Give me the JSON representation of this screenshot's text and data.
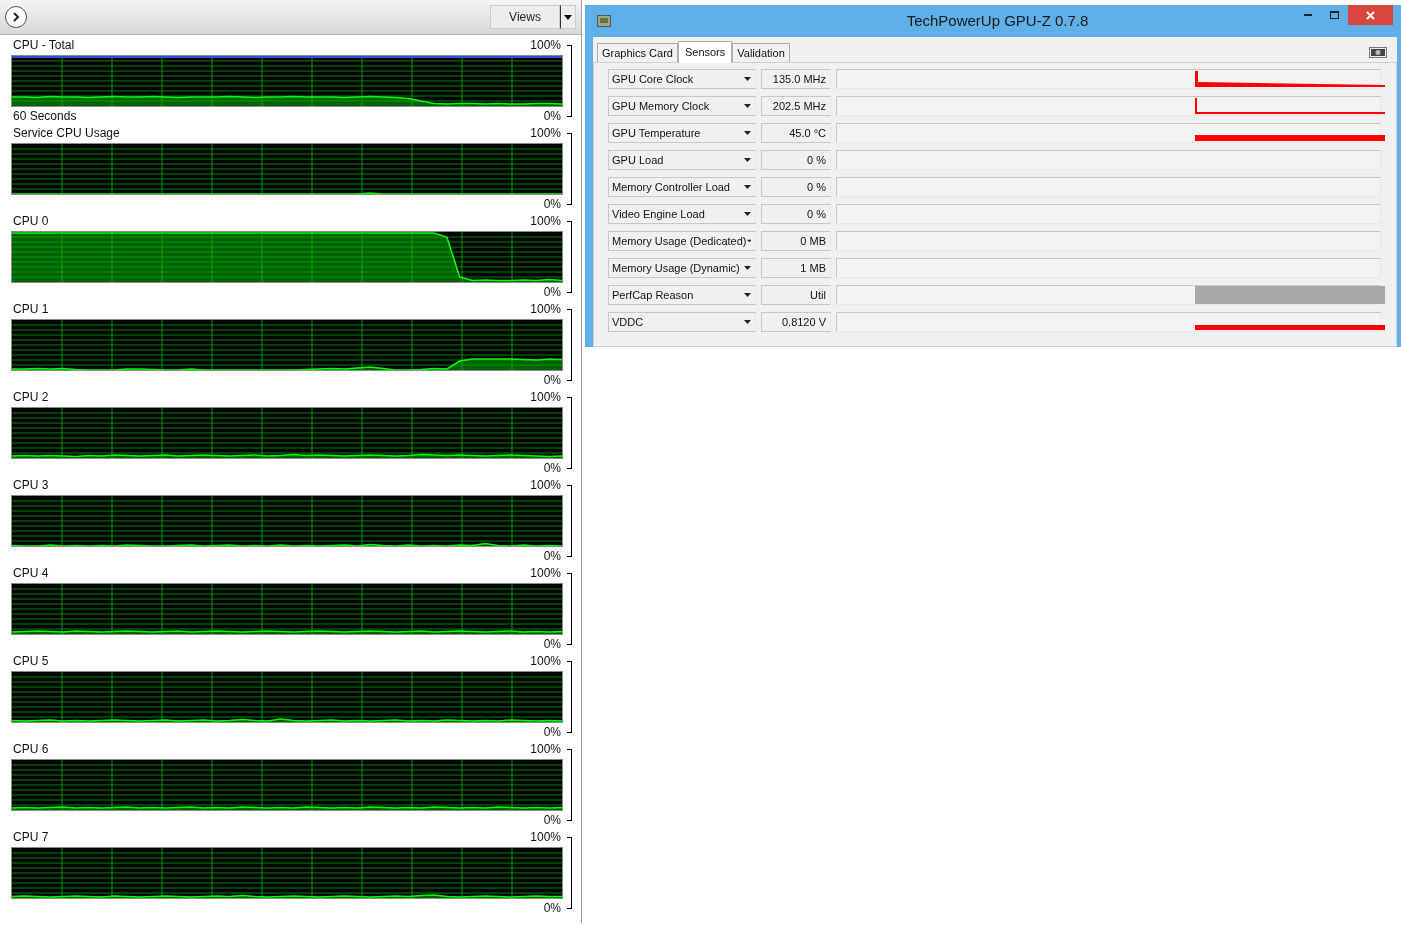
{
  "resource_monitor": {
    "views_button": "Views",
    "graphs": [
      {
        "title": "CPU - Total",
        "max_label": "100%",
        "min_label": "0%",
        "time_label": "60 Seconds"
      },
      {
        "title": "Service CPU Usage",
        "max_label": "100%",
        "min_label": "0%"
      },
      {
        "title": "CPU 0",
        "max_label": "100%",
        "min_label": "0%"
      },
      {
        "title": "CPU 1",
        "max_label": "100%",
        "min_label": "0%"
      },
      {
        "title": "CPU 2",
        "max_label": "100%",
        "min_label": "0%"
      },
      {
        "title": "CPU 3",
        "max_label": "100%",
        "min_label": "0%"
      },
      {
        "title": "CPU 4",
        "max_label": "100%",
        "min_label": "0%"
      },
      {
        "title": "CPU 5",
        "max_label": "100%",
        "min_label": "0%"
      },
      {
        "title": "CPU 6",
        "max_label": "100%",
        "min_label": "0%"
      },
      {
        "title": "CPU 7",
        "max_label": "100%",
        "min_label": "0%"
      }
    ]
  },
  "gpuz": {
    "title": "TechPowerUp GPU-Z 0.7.8",
    "tabs": [
      {
        "label": "Graphics Card",
        "selected": false
      },
      {
        "label": "Sensors",
        "selected": true
      },
      {
        "label": "Validation",
        "selected": false
      }
    ],
    "sensors": [
      {
        "name": "GPU Core Clock",
        "value": "135.0 MHz"
      },
      {
        "name": "GPU Memory Clock",
        "value": "202.5 MHz"
      },
      {
        "name": "GPU Temperature",
        "value": "45.0 °C"
      },
      {
        "name": "GPU Load",
        "value": "0 %"
      },
      {
        "name": "Memory Controller Load",
        "value": "0 %"
      },
      {
        "name": "Video Engine Load",
        "value": "0 %"
      },
      {
        "name": "Memory Usage (Dedicated)",
        "value": "0 MB"
      },
      {
        "name": "Memory Usage (Dynamic)",
        "value": "1 MB"
      },
      {
        "name": "PerfCap Reason",
        "value": "Util"
      },
      {
        "name": "VDDC",
        "value": "0.8120 V"
      }
    ]
  }
}
